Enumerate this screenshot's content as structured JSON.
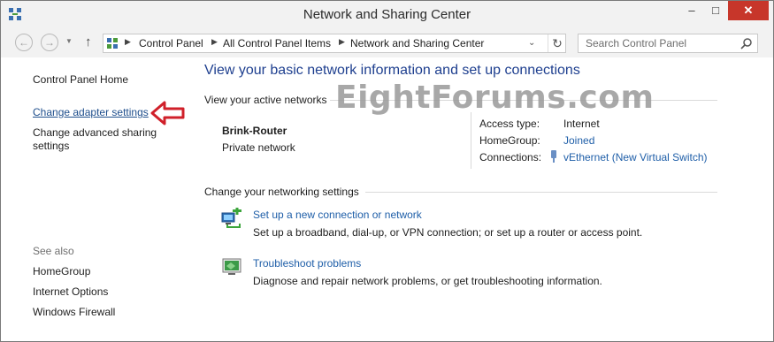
{
  "window": {
    "title": "Network and Sharing Center",
    "controls": {
      "minimize": "–",
      "maximize": "□",
      "close": "✕"
    }
  },
  "nav": {
    "back": "←",
    "forward": "→",
    "up": "↑",
    "breadcrumb": [
      "Control Panel",
      "All Control Panel Items",
      "Network and Sharing Center"
    ],
    "search_placeholder": "Search Control Panel"
  },
  "sidebar": {
    "home": "Control Panel Home",
    "links": [
      "Change adapter settings",
      "Change advanced sharing settings"
    ],
    "see_also_label": "See also",
    "see_also": [
      "HomeGroup",
      "Internet Options",
      "Windows Firewall"
    ]
  },
  "main": {
    "heading": "View your basic network information and set up connections",
    "active_label": "View your active networks",
    "network": {
      "name": "Brink-Router",
      "type": "Private network",
      "access_type_label": "Access type:",
      "access_type": "Internet",
      "homegroup_label": "HomeGroup:",
      "homegroup": "Joined",
      "connections_label": "Connections:",
      "connection": "vEthernet (New Virtual Switch)"
    },
    "change_label": "Change your networking settings",
    "tasks": [
      {
        "title": "Set up a new connection or network",
        "desc": "Set up a broadband, dial-up, or VPN connection; or set up a router or access point."
      },
      {
        "title": "Troubleshoot problems",
        "desc": "Diagnose and repair network problems, or get troubleshooting information."
      }
    ]
  },
  "watermark": "EightForums.com",
  "colors": {
    "link": "#1e5ea8",
    "heading": "#1e3f8f",
    "close": "#c7362a",
    "arrow": "#d0202a"
  }
}
